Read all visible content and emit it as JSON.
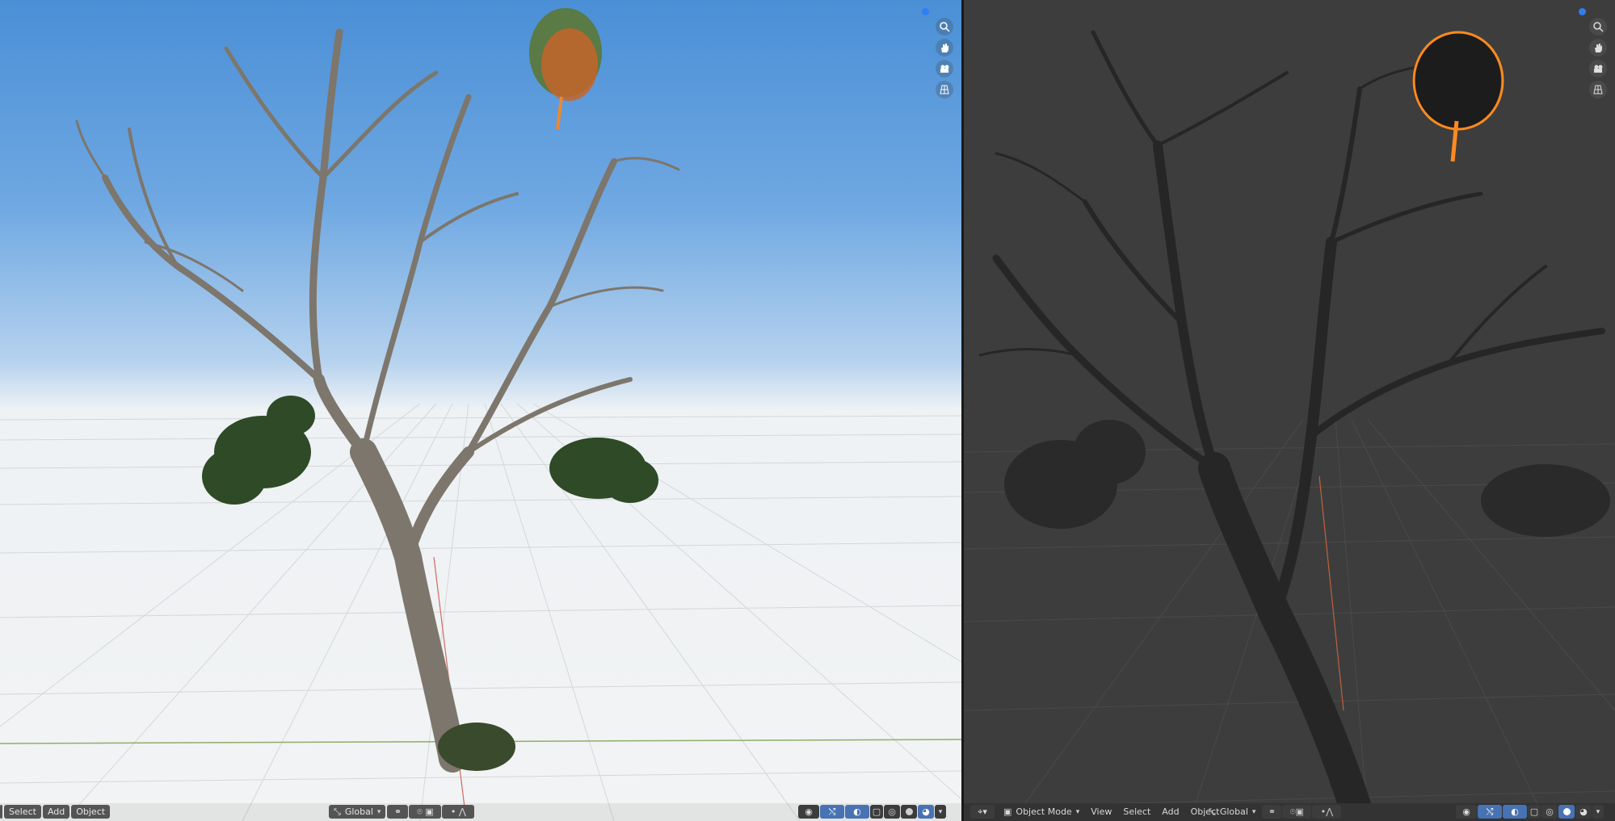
{
  "left_viewport": {
    "header": {
      "select_label": "Select",
      "add_label": "Add",
      "object_label": "Object",
      "orientation_label": "Global"
    }
  },
  "right_viewport": {
    "header": {
      "mode_label": "Object Mode",
      "view_label": "View",
      "select_label": "Select",
      "add_label": "Add",
      "object_label": "Object",
      "orientation_label": "Global"
    }
  },
  "navigation_icons": [
    "zoom-icon",
    "hand-pan-icon",
    "camera-icon",
    "grid-perspective-icon"
  ],
  "colors": {
    "sky_top": "#4a8fd6",
    "floor_light": "#f2f3f4",
    "viewport_dark": "#3d3d3d",
    "accent_blue": "#4772b3",
    "selection_orange": "#ff8a20",
    "leaf_green": "#2e4a26",
    "bark": "#8a8276"
  }
}
